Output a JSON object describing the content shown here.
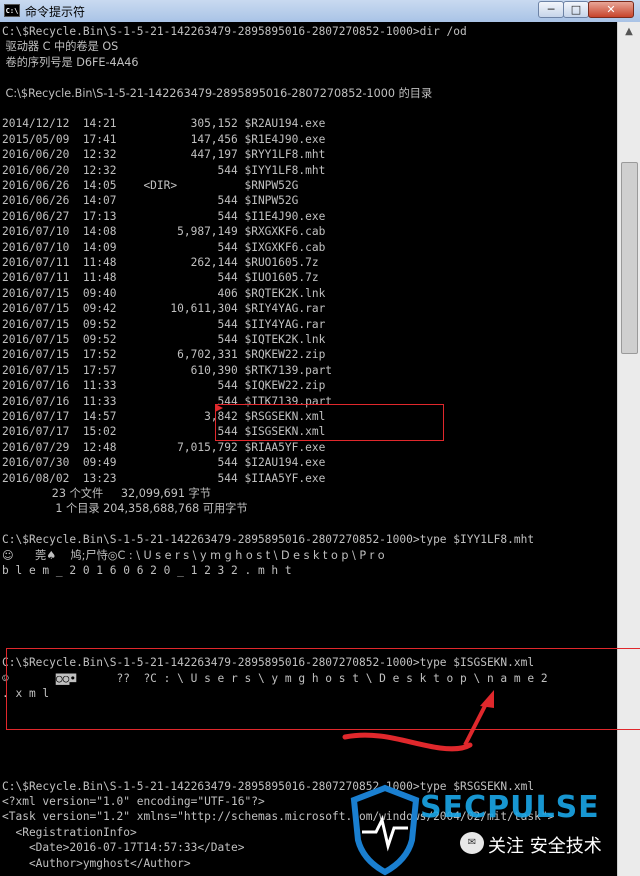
{
  "window": {
    "title": "命令提示符",
    "icon": "cmd-icon",
    "icon_text": "C:\\",
    "controls": {
      "minimize": "─",
      "maximize": "□",
      "close": "✕"
    }
  },
  "console": {
    "lines": [
      "C:\\$Recycle.Bin\\S-1-5-21-142263479-2895895016-2807270852-1000>dir /od",
      " 驱动器 C 中的卷是 OS",
      " 卷的序列号是 D6FE-4A46",
      "",
      " C:\\$Recycle.Bin\\S-1-5-21-142263479-2895895016-2807270852-1000 的目录",
      "",
      "2014/12/12  14:21           305,152 $R2AU194.exe",
      "2015/05/09  17:41           147,456 $R1E4J90.exe",
      "2016/06/20  12:32           447,197 $RYY1LF8.mht",
      "2016/06/20  12:32               544 $IYY1LF8.mht",
      "2016/06/26  14:05    <DIR>          $RNPW52G",
      "2016/06/26  14:07               544 $INPW52G",
      "2016/06/27  17:13               544 $I1E4J90.exe",
      "2016/07/10  14:08         5,987,149 $RXGXKF6.cab",
      "2016/07/10  14:09               544 $IXGXKF6.cab",
      "2016/07/11  11:48           262,144 $RUO1605.7z",
      "2016/07/11  11:48               544 $IUO1605.7z",
      "2016/07/15  09:40               406 $RQTEK2K.lnk",
      "2016/07/15  09:42        10,611,304 $RIY4YAG.rar",
      "2016/07/15  09:52               544 $IIY4YAG.rar",
      "2016/07/15  09:52               544 $IQTEK2K.lnk",
      "2016/07/15  17:52         6,702,331 $RQKEW22.zip",
      "2016/07/15  17:57           610,390 $RTK7139.part",
      "2016/07/16  11:33               544 $IQKEW22.zip",
      "2016/07/16  11:33               544 $ITK7139.part",
      "2016/07/17  14:57             3,842 $RSGSEKN.xml",
      "2016/07/17  15:02               544 $ISGSEKN.xml",
      "2016/07/29  12:48         7,015,792 $RIAA5YF.exe",
      "2016/07/30  09:49               544 $I2AU194.exe",
      "2016/08/02  13:23               544 $IIAA5YF.exe",
      "              23 个文件     32,099,691 字节",
      "               1 个目录 204,358,688,768 可用字节",
      "",
      "C:\\$Recycle.Bin\\S-1-5-21-142263479-2895895016-2807270852-1000>type $IYY1LF8.mht",
      "☺      莞♠    鸠;尸恃◎C : \\ U s e r s \\ y m g h o s t \\ D e s k t o p \\ P r o",
      "b l e m _ 2 0 1 6 0 6 2 0 _ 1 2 3 2 . m h t",
      "",
      "",
      "",
      "",
      "",
      "C:\\$Recycle.Bin\\S-1-5-21-142263479-2895895016-2807270852-1000>type $ISGSEKN.xml",
      "☺       ◙◙◘      ??  ?C : \\ U s e r s \\ y m g h o s t \\ D e s k t o p \\ n a m e 2",
      ". x m l",
      "",
      "",
      "",
      "",
      "",
      "C:\\$Recycle.Bin\\S-1-5-21-142263479-2895895016-2807270852-1000>type $RSGSEKN.xml",
      "<?xml version=\"1.0\" encoding=\"UTF-16\"?>",
      "<Task version=\"1.2\" xmlns=\"http://schemas.microsoft.com/windows/2004/02/mit/task\">",
      "  <RegistrationInfo>",
      "    <Date>2016-07-17T14:57:33</Date>",
      "    <Author>ymghost</Author>"
    ]
  },
  "watermark": {
    "brand": "SECPULSE",
    "subtitle": "关注 安全技术",
    "wechat_icon": "wechat-icon",
    "shield_icon": "shield-icon"
  },
  "colors": {
    "console_text": "#c0c0c0",
    "console_bg": "#000000",
    "annotation_red": "#e0282c",
    "brand_blue": "#1aa7e8"
  }
}
